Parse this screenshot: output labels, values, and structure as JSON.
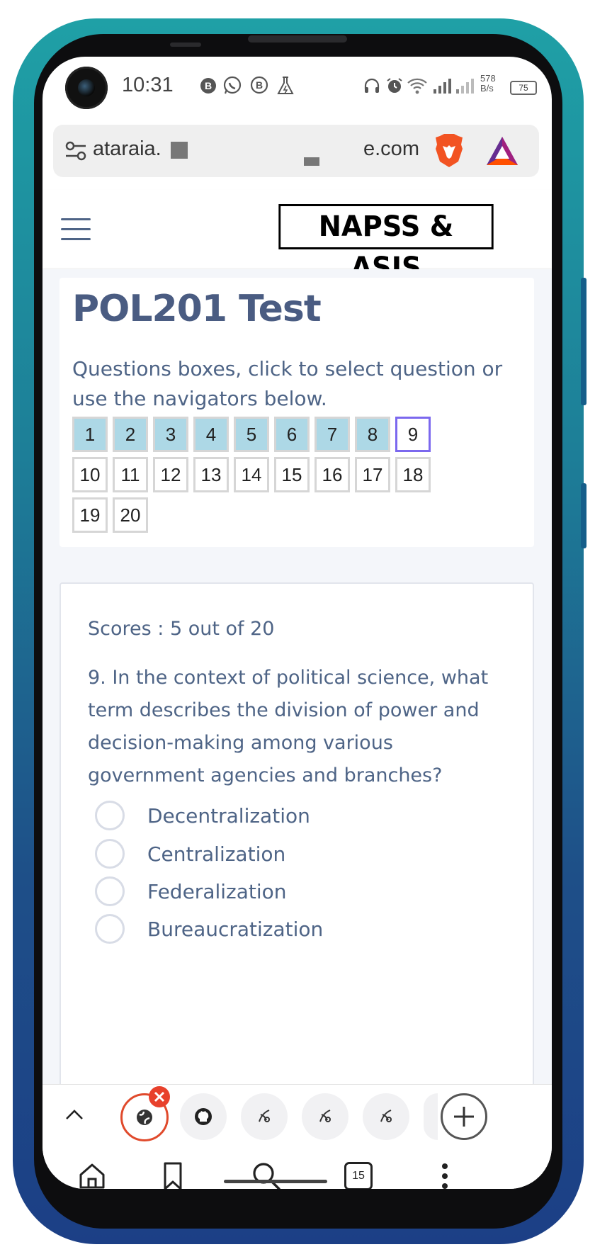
{
  "status_bar": {
    "time": "10:31",
    "net_speed": "578\nB/s",
    "battery": "75",
    "icons": [
      "b-circle-icon",
      "whatsapp-icon",
      "b-bubble-icon",
      "flask-icon",
      "headphones-icon",
      "alarm-icon",
      "wifi-icon",
      "signal-icon",
      "signal-weak-icon"
    ]
  },
  "browser": {
    "url_left": "ataraia.",
    "url_right": "e.com",
    "icons": [
      "site-settings-icon",
      "brave-lion-icon",
      "brave-rewards-icon"
    ]
  },
  "site": {
    "logo": "NAPSS & ASIS",
    "menu_icon": "hamburger-icon"
  },
  "test": {
    "title": "POL201 Test",
    "instructions": "Questions boxes, click to select question or use the navigators below.",
    "question_numbers": [
      "1",
      "2",
      "3",
      "4",
      "5",
      "6",
      "7",
      "8",
      "9",
      "10",
      "11",
      "12",
      "13",
      "14",
      "15",
      "16",
      "17",
      "18",
      "19",
      "20"
    ],
    "answered": [
      1,
      2,
      3,
      4,
      5,
      6,
      7,
      8
    ],
    "current": 9
  },
  "question": {
    "scores": "Scores : 5 out of 20",
    "text": "9. In the context of political science, what term describes the division of power and decision-making among various government agencies and branches?",
    "options": [
      "Decentralization",
      "Centralization",
      "Federalization",
      "Bureaucratization"
    ]
  },
  "tabs": {
    "tab_count": "15",
    "chips": [
      "collapse-icon",
      "active-tab-icon",
      "github-icon",
      "tab-icon",
      "tab-icon",
      "tab-icon",
      "new-tab-icon"
    ]
  },
  "colors": {
    "answered_box": "#add8e6",
    "current_box_border": "#7b68ee",
    "text": "#4e6486",
    "active_tab_ring": "#e04a2c"
  }
}
